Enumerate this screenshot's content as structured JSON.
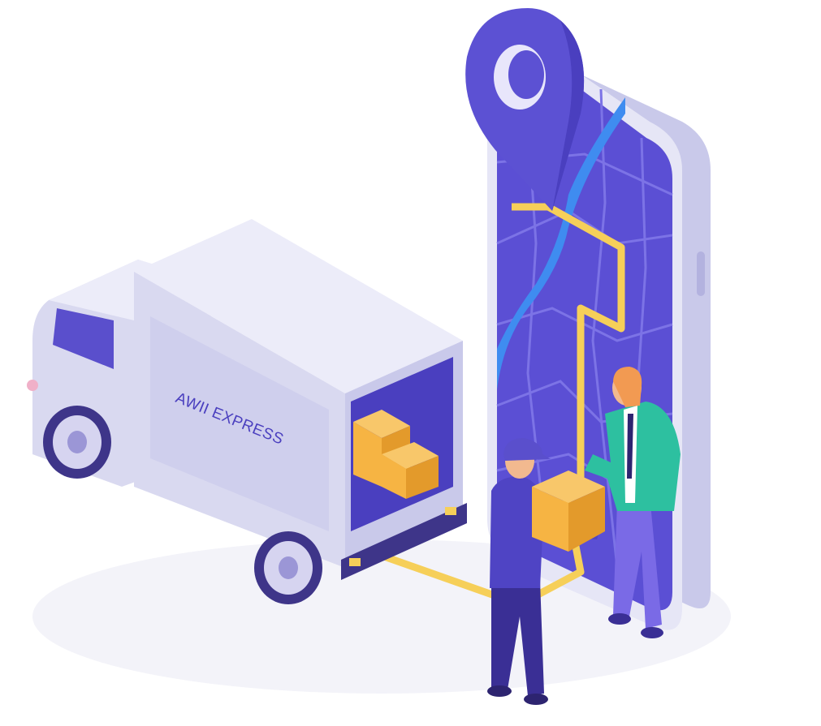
{
  "truck": {
    "label": "AWII EXPRESS"
  },
  "colors": {
    "background": "#ffffff",
    "shadow": "#efeff6",
    "phone_frame": "#e6e6f6",
    "phone_frame_side": "#c9c9ea",
    "phone_screen": "#5b4fd4",
    "map_block": "#5348c9",
    "map_lines": "#7c73e6",
    "river": "#3f8cf0",
    "route": "#f6cf59",
    "pin": "#5c51d3",
    "pin_hole": "#e8e6fb",
    "truck_body": "#d9d9f0",
    "truck_body_light": "#ececf9",
    "truck_body_shade": "#b9b8e2",
    "truck_window": "#5a4fcc",
    "truck_cargo_interior": "#4a3fbf",
    "wheel": "#d6d4f0",
    "wheel_dark": "#3e3589",
    "box": "#f6b443",
    "box_shade": "#e39a2b",
    "courier_shirt": "#4f44c4",
    "courier_pants": "#3a2f95",
    "customer_jacket": "#2dc0a0",
    "customer_pants": "#7a6ae6",
    "skin": "#f2b98f",
    "hair": "#f29a52"
  },
  "icons": [
    "location-pin-icon"
  ]
}
